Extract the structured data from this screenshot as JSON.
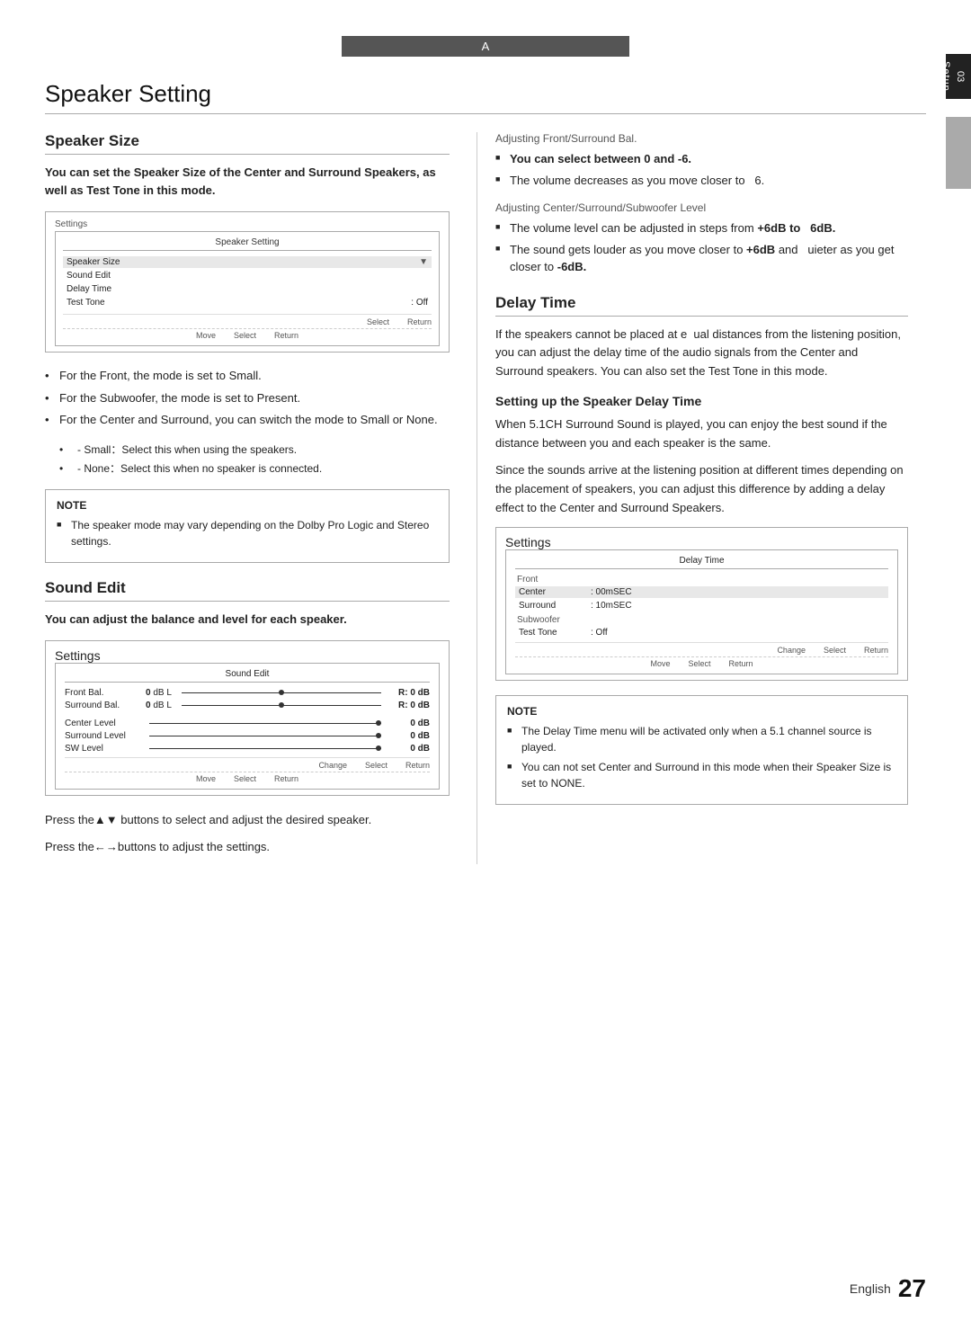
{
  "page": {
    "title": "Speaker Setting",
    "header_a": "A",
    "language": "English",
    "page_number": "27"
  },
  "side_tab": {
    "number": "03",
    "label": "Setup"
  },
  "left_col": {
    "speaker_size": {
      "heading": "Speaker Size",
      "intro": "You can set the Speaker Size of the Center and Surround Speakers, as well as Test Tone in this mode.",
      "screen": {
        "outer_label": "Settings",
        "inner_label": "Speaker Setting",
        "menu_items": [
          {
            "label": "Speaker Size",
            "arrow": "▼",
            "highlighted": true
          },
          {
            "label": "Sound Edit",
            "arrow": ""
          },
          {
            "label": "Delay Time",
            "arrow": ""
          },
          {
            "label": "Test Tone",
            "value": ": Off",
            "arrow": ""
          }
        ],
        "footer": [
          "Select",
          "Return"
        ],
        "footer_nav": [
          "Move",
          "Select",
          "Return"
        ]
      },
      "bullets": [
        "For the Front, the mode is set to Small.",
        "For the Subwoofer, the mode is set to Present.",
        "For the Center and Surround, you can switch the mode to Small or None."
      ],
      "sub_bullets": [
        "Small：Select this when using the speakers.",
        "None：Select this when no speaker is connected."
      ],
      "note": {
        "title": "NOTE",
        "items": [
          "The speaker mode may vary depending on the Dolby Pro Logic and Stereo settings."
        ]
      }
    },
    "sound_edit": {
      "heading": "Sound Edit",
      "intro": "You can adjust the balance and level for each speaker.",
      "screen": {
        "outer_label": "Settings",
        "inner_label": "Sound Edit",
        "rows": [
          {
            "label": "Front Bal.",
            "left": "0 dB L",
            "right": "R: 0 dB",
            "has_bar": true,
            "dot_pos": "center"
          },
          {
            "label": "Surround Bal.",
            "left": "0 dB L",
            "right": "R: 0 dB",
            "has_bar": true,
            "dot_pos": "center"
          },
          {
            "label": "",
            "spacer": true
          },
          {
            "label": "Center Level",
            "value": "0 dB",
            "has_bar": true,
            "dot_pos": "right"
          },
          {
            "label": "Surround Level",
            "value": "0 dB",
            "has_bar": true,
            "dot_pos": "right"
          },
          {
            "label": "SW Level",
            "value": "0 dB",
            "has_bar": true,
            "dot_pos": "right"
          }
        ],
        "footer": [
          "Change",
          "Select",
          "Return"
        ],
        "footer_nav": [
          "Move",
          "Select",
          "Return"
        ]
      },
      "press_texts": [
        "Press the▲▼ buttons to select and adjust the desired speaker.",
        "Press the←→buttons to adjust the settings."
      ]
    }
  },
  "right_col": {
    "adjusting_front": {
      "label": "Adjusting Front/Surround Bal.",
      "items": [
        "You can select between 0 and -6.",
        "The volume decreases as you move closer to   6."
      ]
    },
    "adjusting_center": {
      "label": "Adjusting Center/Surround/Subwoofer Level",
      "items": [
        "The volume level can be adjusted in steps from +6dB to  6dB.",
        "The sound gets louder as you move closer to +6dB and   uieter as you get closer to -6dB."
      ]
    },
    "delay_time": {
      "heading": "Delay Time",
      "body1": "If the speakers cannot be placed at e  ual distances from the listening position, you can adjust the delay time of the audio signals from the Center and Surround speakers. You can also set the Test Tone in this mode.",
      "sub_heading": "Setting up the Speaker Delay Time",
      "body2": "When 5.1CH Surround Sound is played, you can enjoy the best sound if the distance between you and each speaker is the same.",
      "body3": "Since the sounds arrive at the listening position at different times depending on the placement of speakers, you can adjust this difference by adding a delay effect to the Center and Surround Speakers.",
      "screen": {
        "outer_label": "Settings",
        "inner_label": "Delay Time",
        "sections": [
          {
            "label": "Front",
            "rows": []
          },
          {
            "label": "",
            "rows": [
              {
                "label": "Center",
                "value": ": 00mSEC",
                "highlighted": true
              },
              {
                "label": "Surround",
                "value": ": 10mSEC"
              }
            ]
          },
          {
            "label": "Subwoofer",
            "rows": []
          },
          {
            "label": "",
            "rows": [
              {
                "label": "Test Tone",
                "value": ": Off"
              }
            ]
          }
        ],
        "footer": [
          "Change",
          "Select",
          "Return"
        ],
        "footer_nav": [
          "Move",
          "Select",
          "Return"
        ]
      },
      "note": {
        "title": "NOTE",
        "items": [
          "The Delay Time menu will be activated only when a 5.1 channel source is played.",
          "You can not set Center and Surround in this mode when their Speaker Size is set to NONE."
        ]
      }
    }
  }
}
